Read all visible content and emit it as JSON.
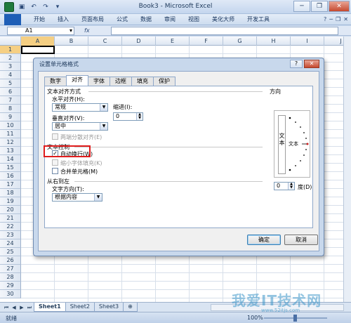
{
  "window": {
    "title": "Book3 - Microsoft Excel",
    "minimize": "─",
    "restore": "❐",
    "close": "✕"
  },
  "ribbon": {
    "file_label": "",
    "tabs": [
      "开始",
      "插入",
      "页面布局",
      "公式",
      "数据",
      "审阅",
      "视图",
      "美化大师",
      "开发工具"
    ],
    "right_icons": [
      "?",
      "─",
      "❐",
      "✕"
    ]
  },
  "formula_bar": {
    "name_box": "A1",
    "fx": "fx",
    "value": ""
  },
  "columns": [
    "A",
    "B",
    "C",
    "D",
    "E",
    "F",
    "G",
    "H",
    "I",
    "J"
  ],
  "rows": [
    "1",
    "2",
    "3",
    "4",
    "5",
    "6",
    "7",
    "8",
    "9",
    "10",
    "11",
    "12",
    "13",
    "14",
    "15",
    "16",
    "17",
    "18",
    "19",
    "20",
    "21",
    "22",
    "23",
    "24",
    "25",
    "26",
    "27",
    "28",
    "29",
    "30"
  ],
  "sheets": [
    "Sheet1",
    "Sheet2",
    "Sheet3"
  ],
  "status": {
    "ready": "就绪",
    "zoom": "100%"
  },
  "dialog": {
    "title": "设置单元格格式",
    "help": "?",
    "close": "✕",
    "tabs": [
      "数字",
      "对齐",
      "字体",
      "边框",
      "填充",
      "保护"
    ],
    "active_tab": "对齐",
    "text_alignment": {
      "section": "文本对齐方式",
      "horizontal_label": "水平对齐(H):",
      "horizontal_value": "常规",
      "indent_label": "缩进(I):",
      "indent_value": "0",
      "vertical_label": "垂直对齐(V):",
      "vertical_value": "居中",
      "distributed_label": "两端分散对齐(E)"
    },
    "text_control": {
      "section": "文本控制",
      "wrap_label": "自动换行(W)",
      "wrap_checked": true,
      "shrink_label": "缩小字体填充(K)",
      "merge_label": "合并单元格(M)"
    },
    "rtl": {
      "section": "从右到左",
      "direction_label": "文字方向(T):",
      "direction_value": "根据内容"
    },
    "orientation": {
      "section": "方向",
      "vertical_text": "文本",
      "dial_text": "文本",
      "degrees_value": "0",
      "degrees_label": "度(D)"
    },
    "ok_label": "确定",
    "cancel_label": "取消"
  },
  "watermark": {
    "text": "我爱IT技术网",
    "url": "www.52itjs.com"
  }
}
